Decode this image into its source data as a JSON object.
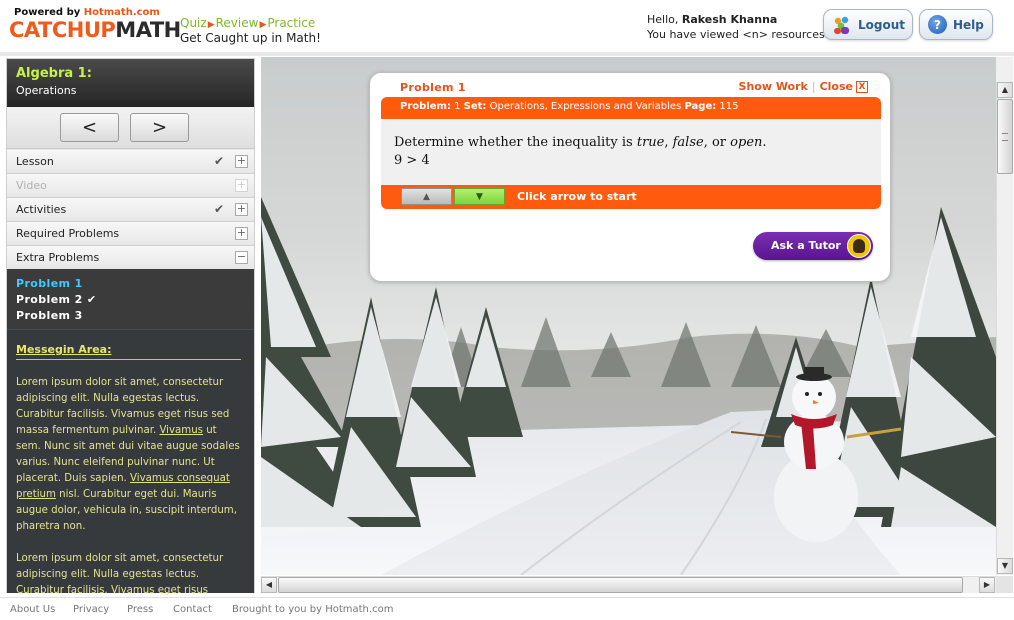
{
  "header": {
    "powered_prefix": "Powered by ",
    "powered_brand": "Hotmath.com",
    "logo_part1": "CATCHUP",
    "logo_part2": "MATH",
    "tag_quiz": "Quiz",
    "tag_review": "Review",
    "tag_practice": "Practice",
    "tag_sub": "Get Caught up in Math!",
    "hello_prefix": "Hello, ",
    "user_name": "Rakesh Khanna",
    "viewed_text": "You have viewed <n> resources!",
    "logout_label": "Logout",
    "help_label": "Help"
  },
  "sidebar": {
    "course_title": "Algebra 1:",
    "course_sub": "Operations",
    "prev_label": "<",
    "next_label": ">",
    "items": [
      {
        "label": "Lesson",
        "checked": true,
        "toggle": "+"
      },
      {
        "label": "Video",
        "checked": false,
        "toggle": "+"
      },
      {
        "label": "Activities",
        "checked": true,
        "toggle": "+"
      },
      {
        "label": "Required Problems",
        "checked": false,
        "toggle": "+"
      },
      {
        "label": "Extra Problems",
        "checked": false,
        "toggle": "−"
      }
    ],
    "check_glyph": "✔",
    "problems": [
      "Problem 1",
      "Problem 2 ✔",
      "Problem 3"
    ],
    "message_title": "Messegin Area:",
    "message_p1_a": "Lorem ipsum dolor sit amet, consectetur adipiscing elit. Nulla egestas lectus. Curabitur facilisis. Vivamus eget risus sed massa fermentum pulvinar. ",
    "message_p1_link1": "Vivamus",
    "message_p1_b": " ut sem. Nunc sit amet dui vitae augue sodales varius. Nunc eleifend pulvinar nunc. Ut placerat. Duis sapien. ",
    "message_p1_link2": "Vivamus consequat pretium",
    "message_p1_c": " nisl. Curabitur eget dui. Mauris augue dolor, vehicula in, suscipit interdum, pharetra non.",
    "message_p2": "Lorem ipsum dolor sit amet, consectetur adipiscing elit. Nulla egestas lectus. Curabitur facilisis. Vivamus eget risus"
  },
  "card": {
    "title": "Problem 1",
    "show_work": "Show Work",
    "close_label": "Close",
    "close_x": "X",
    "bar_problem_label": "Problem:",
    "bar_problem_value": " 1 ",
    "bar_set_label": "Set:",
    "bar_set_value": " Operations, Expressions and Variables  ",
    "bar_page_label": "Page:",
    "bar_page_value": " 115",
    "q_prefix": "Determine whether the inequality is ",
    "q_true": "true",
    "q_comma1": ", ",
    "q_false": "false",
    "q_or": ", or ",
    "q_open": "open",
    "q_end": ".",
    "expression": "9 > 4",
    "start_label": "Click arrow to start",
    "tutor_label": "Ask a Tutor"
  },
  "footer": {
    "about": "About Us",
    "privacy": "Privacy",
    "press": "Press",
    "contact": "Contact",
    "brought": "Brought to you by Hotmath.com"
  },
  "colors": {
    "brand_orange": "#ff5a0e",
    "accent_green": "#7db92e",
    "tutor_purple": "#5b1491",
    "sidebar_dark": "#363a3c"
  }
}
